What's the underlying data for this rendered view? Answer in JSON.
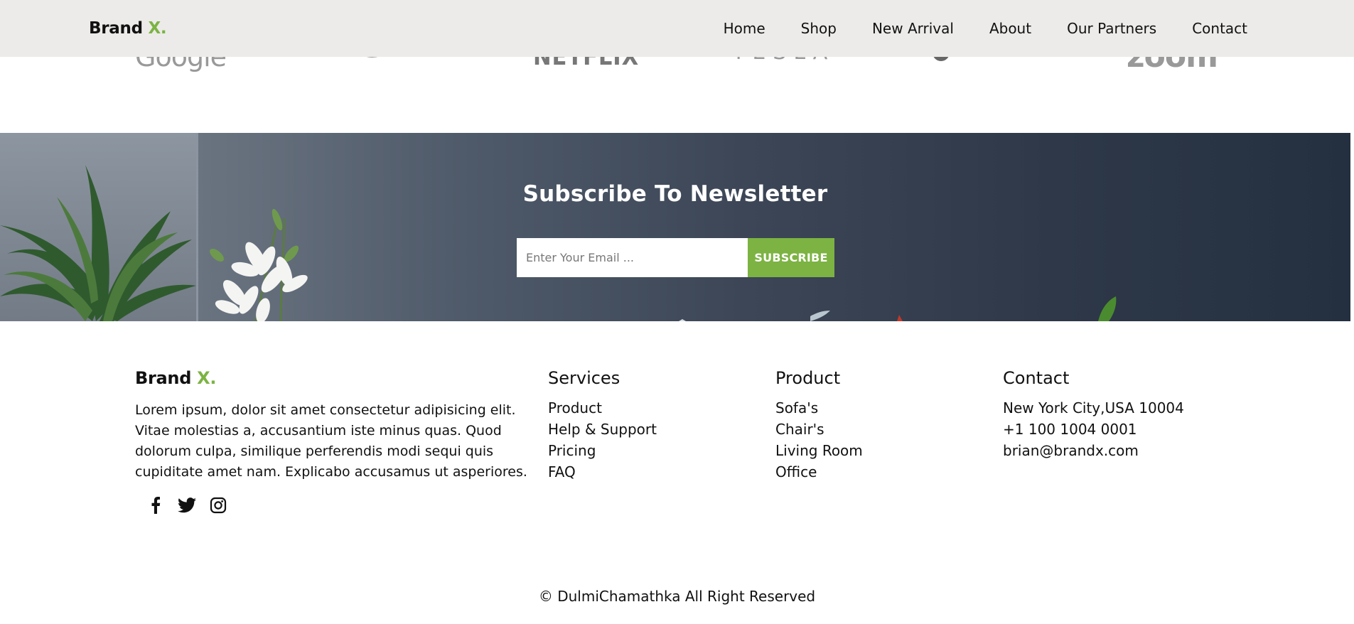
{
  "header": {
    "brand": "Brand",
    "brand_accent": "X.",
    "nav": [
      "Home",
      "Shop",
      "New Arrival",
      "About",
      "Our Partners",
      "Contact"
    ]
  },
  "partners": {
    "logos": [
      {
        "name": "google",
        "text": "Google"
      },
      {
        "name": "amazon",
        "text": ""
      },
      {
        "name": "netflix",
        "text": "NETFLIX"
      },
      {
        "name": "tesla",
        "text": "TESLA"
      },
      {
        "name": "starbucks",
        "text": ""
      },
      {
        "name": "zoom",
        "text": "zoom"
      }
    ]
  },
  "newsletter": {
    "title": "Subscribe To Newsletter",
    "email_placeholder": "Enter Your Email ...",
    "button_label": "SUBSCRIBE"
  },
  "footer": {
    "brand": "Brand",
    "brand_accent": "X.",
    "about": "Lorem ipsum, dolor sit amet consectetur adipisicing elit. Vitae molestias a, accusantium iste minus quas. Quod dolorum culpa, similique perferendis modi sequi quis cupiditate amet nam. Explicabo accusamus ut asperiores.",
    "socials": [
      "facebook-icon",
      "twitter-icon",
      "instagram-icon"
    ],
    "services": {
      "title": "Services",
      "items": [
        "Product",
        "Help & Support",
        "Pricing",
        "FAQ"
      ]
    },
    "product": {
      "title": "Product",
      "items": [
        "Sofa's",
        "Chair's",
        "Living Room",
        "Office"
      ]
    },
    "contact": {
      "title": "Contact",
      "items": [
        "New York City,USA 10004",
        "+1 100 1004 0001",
        "brian@brandx.com"
      ]
    },
    "copyright": "© DulmiChamathka All Right Reserved"
  },
  "colors": {
    "accent": "#7cb342",
    "header_bg": "#ecebe9",
    "newsletter_dark": "#243040"
  }
}
